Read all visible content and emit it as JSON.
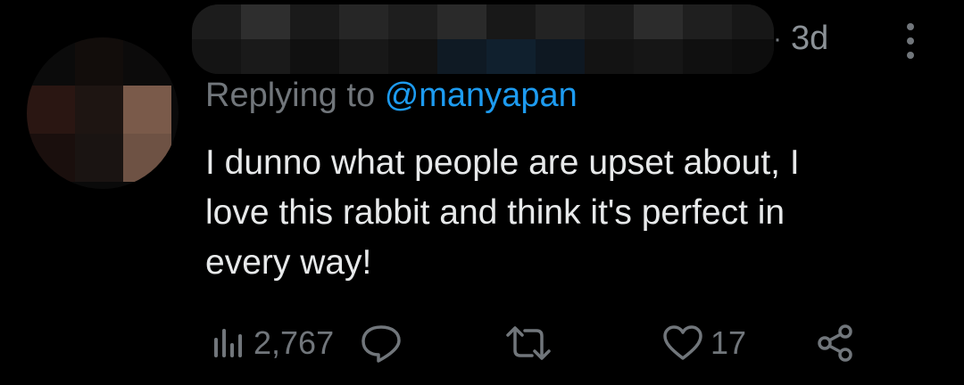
{
  "header": {
    "separator": "·",
    "time_ago": "3d"
  },
  "reply": {
    "prefix": "Replying to",
    "handle": "@manyapan"
  },
  "body": {
    "lines": [
      "I dunno what people are upset about, I",
      "love this rabbit and think it's perfect in",
      "every way!"
    ]
  },
  "actions": {
    "views_count": "2,767",
    "likes_count": "17",
    "icons": [
      "views-icon",
      "reply-icon",
      "retweet-icon",
      "like-icon",
      "share-icon"
    ]
  },
  "colors": {
    "background": "#000000",
    "text": "#e7e9ea",
    "muted": "#71767b",
    "link": "#1d9bf0"
  }
}
